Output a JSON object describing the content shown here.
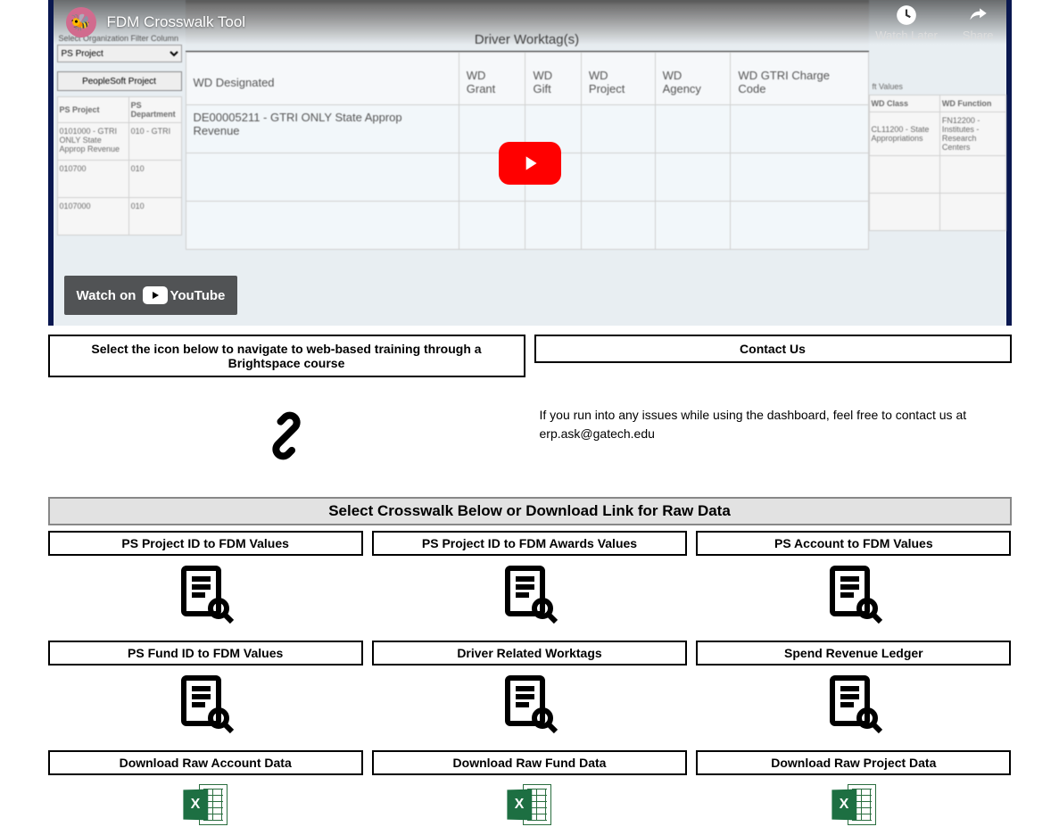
{
  "video": {
    "title": "FDM Crosswalk Tool",
    "watch_later": "Watch Later",
    "share": "Share",
    "watch_on": "Watch on",
    "youtube": "YouTube"
  },
  "dashboard": {
    "filter_label": "Select Organization Filter Column",
    "filter_value": "PS Project",
    "ps_button": "PeopleSoft Project",
    "driver_header": "Driver Worktag(s)",
    "left_cols": [
      "PS Project",
      "PS Department"
    ],
    "left_rows": [
      {
        "proj": "0101000 - GTRI ONLY State Approp Revenue",
        "dept": "010 - GTRI"
      },
      {
        "proj": "010700",
        "dept": "010"
      },
      {
        "proj": "0107000",
        "dept": "010"
      }
    ],
    "main_cols": [
      "WD Designated",
      "WD Grant",
      "WD Gift",
      "WD Project",
      "WD Agency",
      "WD GTRI Charge Code"
    ],
    "main_rows": [
      [
        "DE00005211 - GTRI ONLY State Approp Revenue",
        "",
        "",
        "",
        "",
        ""
      ],
      [
        "",
        "",
        "",
        "",
        "",
        ""
      ],
      [
        "",
        "",
        "",
        "",
        "",
        ""
      ]
    ],
    "right_label": "ft Values",
    "right_cols": [
      "WD Class",
      "WD Function"
    ],
    "right_rows": [
      [
        "CL11200 - State Appropriations",
        "FN12200 - Institutes - Research Centers"
      ],
      [
        "",
        ""
      ],
      [
        "",
        ""
      ]
    ]
  },
  "training": {
    "header": "Select the icon below to navigate to web-based training through a Brightspace course"
  },
  "contact": {
    "header": "Contact Us",
    "body": "If you run into any issues while using the dashboard, feel free to contact us at erp.ask@gatech.edu"
  },
  "section_banner": "Select Crosswalk Below or Download Link for Raw Data",
  "tiles": {
    "r1": [
      "PS Project ID to FDM Values",
      "PS Project ID to FDM Awards Values",
      "PS Account to FDM Values"
    ],
    "r2": [
      "PS Fund ID to FDM Values",
      "Driver Related Worktags",
      "Spend Revenue Ledger"
    ],
    "r3": [
      "Download Raw Account Data",
      "Download Raw Fund Data",
      "Download Raw Project Data"
    ]
  },
  "excel_x": "X"
}
